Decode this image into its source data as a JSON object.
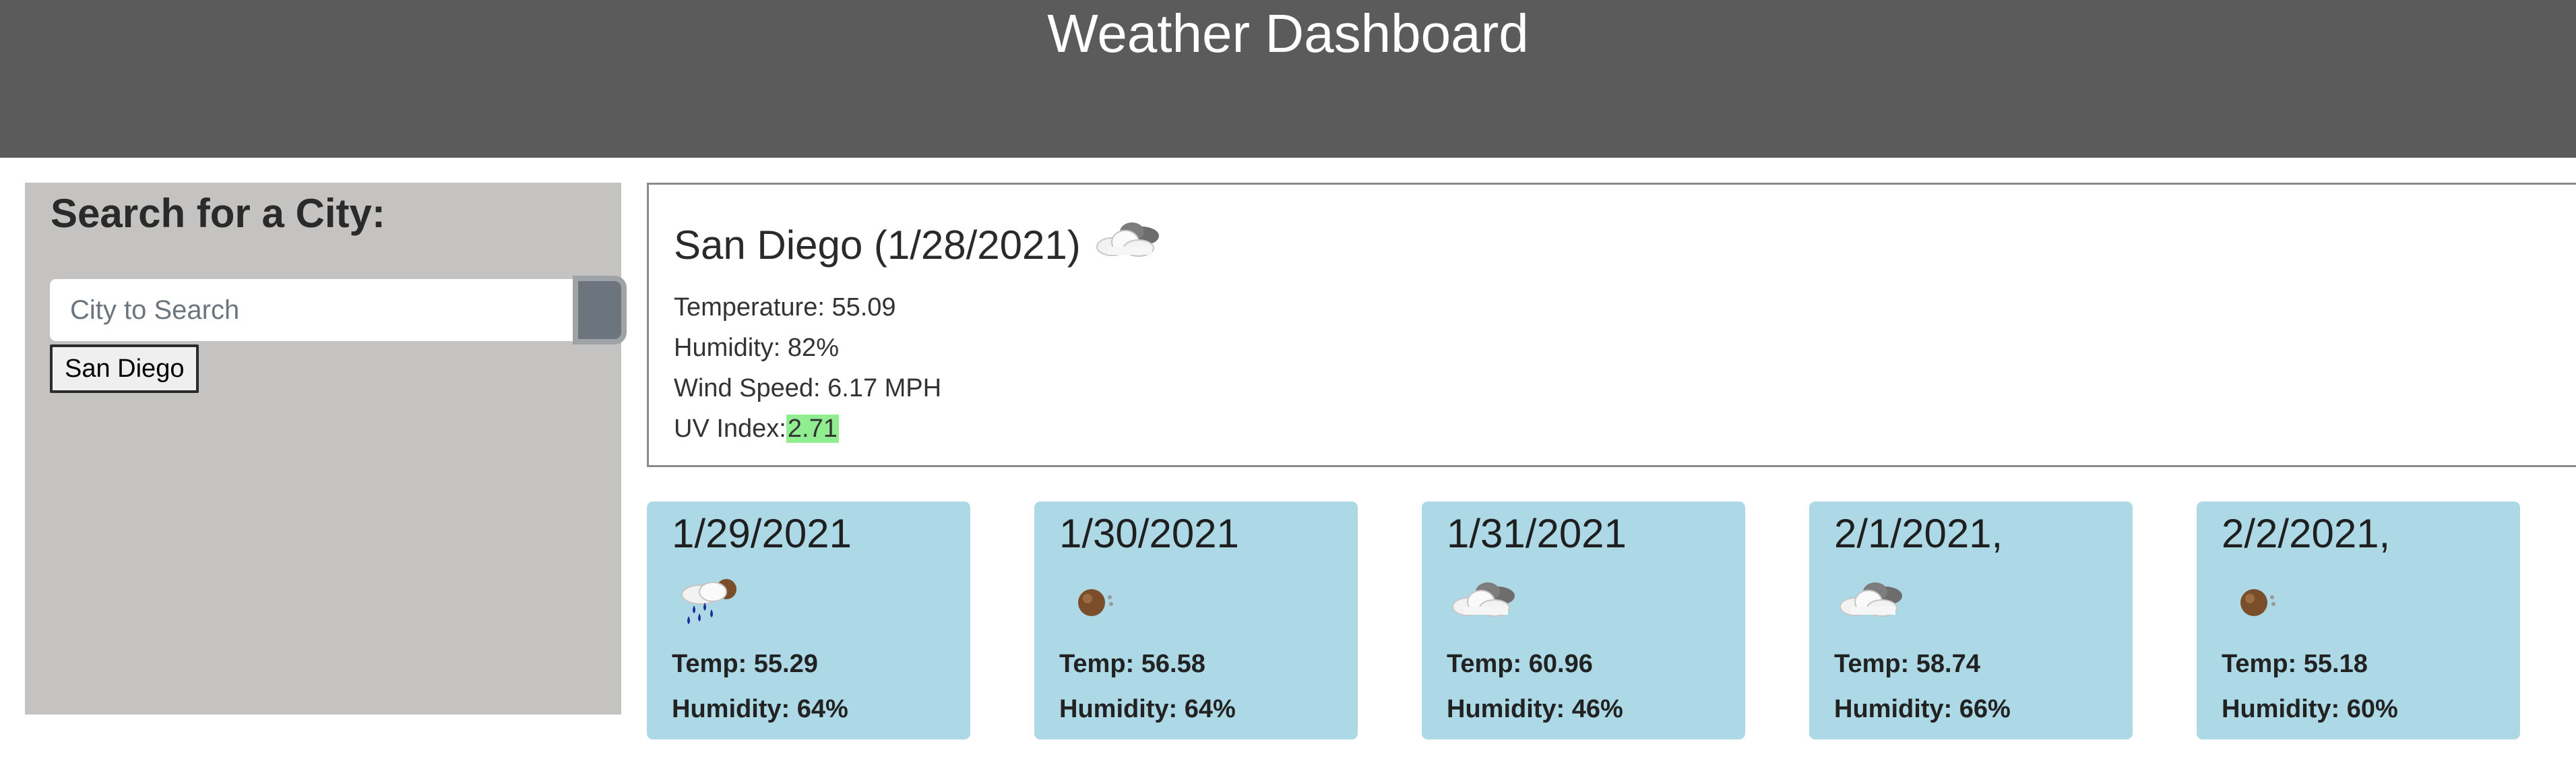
{
  "header": {
    "title": "Weather Dashboard"
  },
  "sidebar": {
    "heading": "Search for a City:",
    "search": {
      "placeholder": "City to Search",
      "value": ""
    },
    "search_button_icon": "search-icon",
    "history": [
      "San Diego"
    ]
  },
  "current": {
    "city_date": "San Diego (1/28/2021)",
    "icon": "broken-clouds-icon",
    "temperature": "Temperature: 55.09",
    "humidity": "Humidity: 82%",
    "wind": "Wind Speed: 6.17 MPH",
    "uv_label": "UV Index:",
    "uv_value": "2.71",
    "uv_color": "#90ee90"
  },
  "forecast": [
    {
      "date": "1/29/2021",
      "icon": "rain-icon",
      "temp": "Temp: 55.29",
      "humidity": "Humidity: 64%"
    },
    {
      "date": "1/30/2021",
      "icon": "clear-sky-icon",
      "temp": "Temp: 56.58",
      "humidity": "Humidity: 64%"
    },
    {
      "date": "1/31/2021",
      "icon": "broken-clouds-icon",
      "temp": "Temp: 60.96",
      "humidity": "Humidity: 46%"
    },
    {
      "date": "2/1/2021,",
      "icon": "broken-clouds-icon",
      "temp": "Temp: 58.74",
      "humidity": "Humidity: 66%"
    },
    {
      "date": "2/2/2021,",
      "icon": "clear-sky-icon",
      "temp": "Temp: 55.18",
      "humidity": "Humidity: 60%"
    }
  ],
  "colors": {
    "header_bg": "#5b5b5b",
    "sidebar_bg": "#c4c3c2",
    "card_bg": "#add8e6"
  }
}
